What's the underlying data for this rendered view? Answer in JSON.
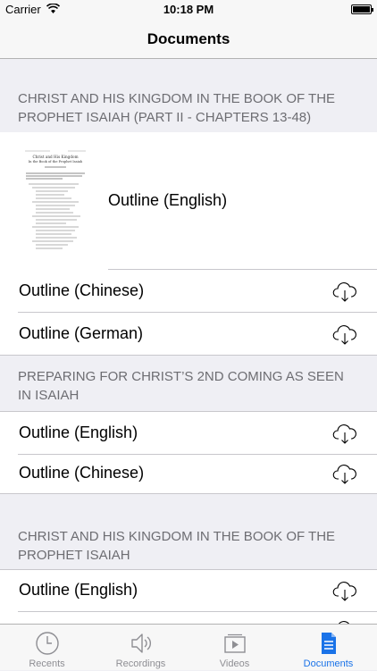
{
  "status": {
    "carrier": "Carrier",
    "time": "10:18 PM"
  },
  "nav": {
    "title": "Documents"
  },
  "sections": [
    {
      "header": "CHRIST AND HIS KINGDOM IN THE BOOK OF THE PROPHET ISAIAH (PART II - CHAPTERS 13-48)",
      "thumbnail": {
        "title_line1": "Christ and His Kingdom",
        "title_line2": "In the Book of the Prophet Isaiah"
      },
      "rows": [
        {
          "label": "Outline (English)",
          "downloaded": true
        },
        {
          "label": "Outline (Chinese)",
          "downloaded": false
        },
        {
          "label": "Outline (German)",
          "downloaded": false
        }
      ]
    },
    {
      "header": "PREPARING FOR CHRIST’S 2ND COMING AS SEEN IN ISAIAH",
      "rows": [
        {
          "label": "Outline (English)",
          "downloaded": false
        },
        {
          "label": "Outline (Chinese)",
          "downloaded": false
        }
      ]
    },
    {
      "header": "CHRIST AND HIS KINGDOM IN THE BOOK OF THE PROPHET ISAIAH",
      "rows": [
        {
          "label": "Outline (English)",
          "downloaded": false
        }
      ]
    }
  ],
  "tabs": [
    {
      "label": "Recents",
      "icon": "clock-icon",
      "active": false
    },
    {
      "label": "Recordings",
      "icon": "speaker-icon",
      "active": false
    },
    {
      "label": "Videos",
      "icon": "video-icon",
      "active": false
    },
    {
      "label": "Documents",
      "icon": "document-icon",
      "active": true
    }
  ],
  "colors": {
    "accent": "#1a73e8",
    "header_text": "#6d6d72",
    "background": "#efeff4"
  }
}
